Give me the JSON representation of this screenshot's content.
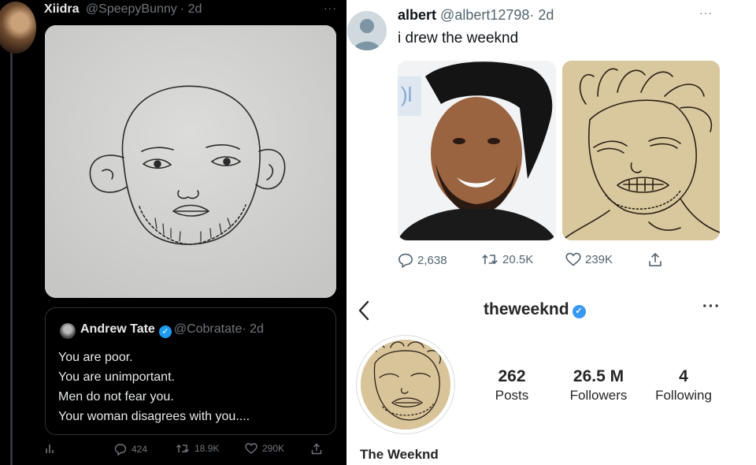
{
  "left_tweet": {
    "author_name": "Xiidra",
    "author_handle": "@SpeepyBunny",
    "time": "· 2d",
    "more": "···",
    "quote": {
      "author_name": "Andrew Tate",
      "author_handle": "@Cobratate",
      "time": "· 2d",
      "lines": [
        "You are poor.",
        "You are unimportant.",
        "Men do not fear you.",
        "Your woman disagrees with you...."
      ]
    },
    "stats": {
      "replies": "424",
      "retweets": "18.9K",
      "likes": "290K"
    }
  },
  "right_tweet": {
    "author_name": "albert",
    "author_handle": "@albert12798",
    "time": "· 2d",
    "more": "···",
    "text": "i drew the weeknd",
    "stats": {
      "replies": "2,638",
      "retweets": "20.5K",
      "likes": "239K"
    }
  },
  "instagram": {
    "username": "theweeknd",
    "more": "···",
    "display_name": "The Weeknd",
    "posts": "262",
    "posts_label": "Posts",
    "followers": "26.5 M",
    "followers_label": "Followers",
    "following": "4",
    "following_label": "Following"
  },
  "colors": {
    "twitter_blue": "#1d9bf0",
    "instagram_blue": "#3897f0"
  },
  "icons": [
    "reply-icon",
    "retweet-icon",
    "like-icon",
    "share-icon",
    "analytics-icon",
    "verified-badge-icon",
    "back-arrow-icon",
    "more-icon"
  ]
}
